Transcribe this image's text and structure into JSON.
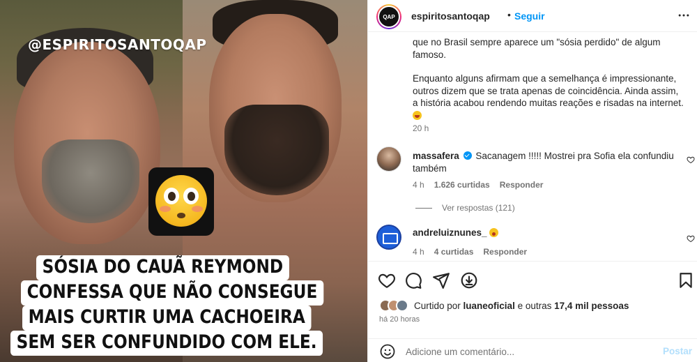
{
  "media": {
    "watermark": "@ESPIRITOSANTOQAP",
    "caption_lines": [
      "SÓSIA DO CAUÃ REYMOND",
      "CONFESSA QUE NÃO CONSEGUE",
      "MAIS CURTIR UMA CACHOEIRA",
      "SEM SER CONFUNDIDO COM ELE."
    ],
    "sticker_icon": "flushed-face-emoji"
  },
  "header": {
    "username": "espiritosantoqap",
    "separator": "•",
    "follow_label": "Seguir",
    "avatar_text": "QAP",
    "more_icon": "more-horizontal-icon"
  },
  "caption": {
    "paragraph1": "que no Brasil sempre aparece um \"sósia perdido\" de algum famoso.",
    "paragraph2": "Enquanto alguns afirmam que a semelhança é impressionante, outros dizem que se trata apenas de coincidência. Ainda assim, a história acabou rendendo muitas reações e risadas na internet.",
    "time": "20 h"
  },
  "comments": [
    {
      "username": "massafera",
      "verified": true,
      "text": "Sacanagem !!!!! Mostrei pra Sofia ela confundiu também",
      "time": "4 h",
      "likes": "1.626 curtidas",
      "reply_label": "Responder",
      "view_replies": "Ver respostas (121)"
    },
    {
      "username": "andreluiznunes_",
      "text": "",
      "time": "4 h",
      "likes": "4 curtidas",
      "reply_label": "Responder"
    }
  ],
  "actions": {
    "icons": [
      "heart-icon",
      "comment-icon",
      "share-icon",
      "save-circle-icon",
      "bookmark-icon"
    ],
    "liked_by_prefix": "Curtido por ",
    "liked_by_user": "luaneoficial",
    "liked_by_suffix": " e outras ",
    "likes_count": "17,4 mil pessoas",
    "posted_ago": "há 20 horas"
  },
  "add_comment": {
    "placeholder": "Adicione um comentário...",
    "post_label": "Postar"
  },
  "colors": {
    "link_blue": "#0095f6",
    "post_disabled": "#b2dffc",
    "meta_gray": "#737373"
  }
}
